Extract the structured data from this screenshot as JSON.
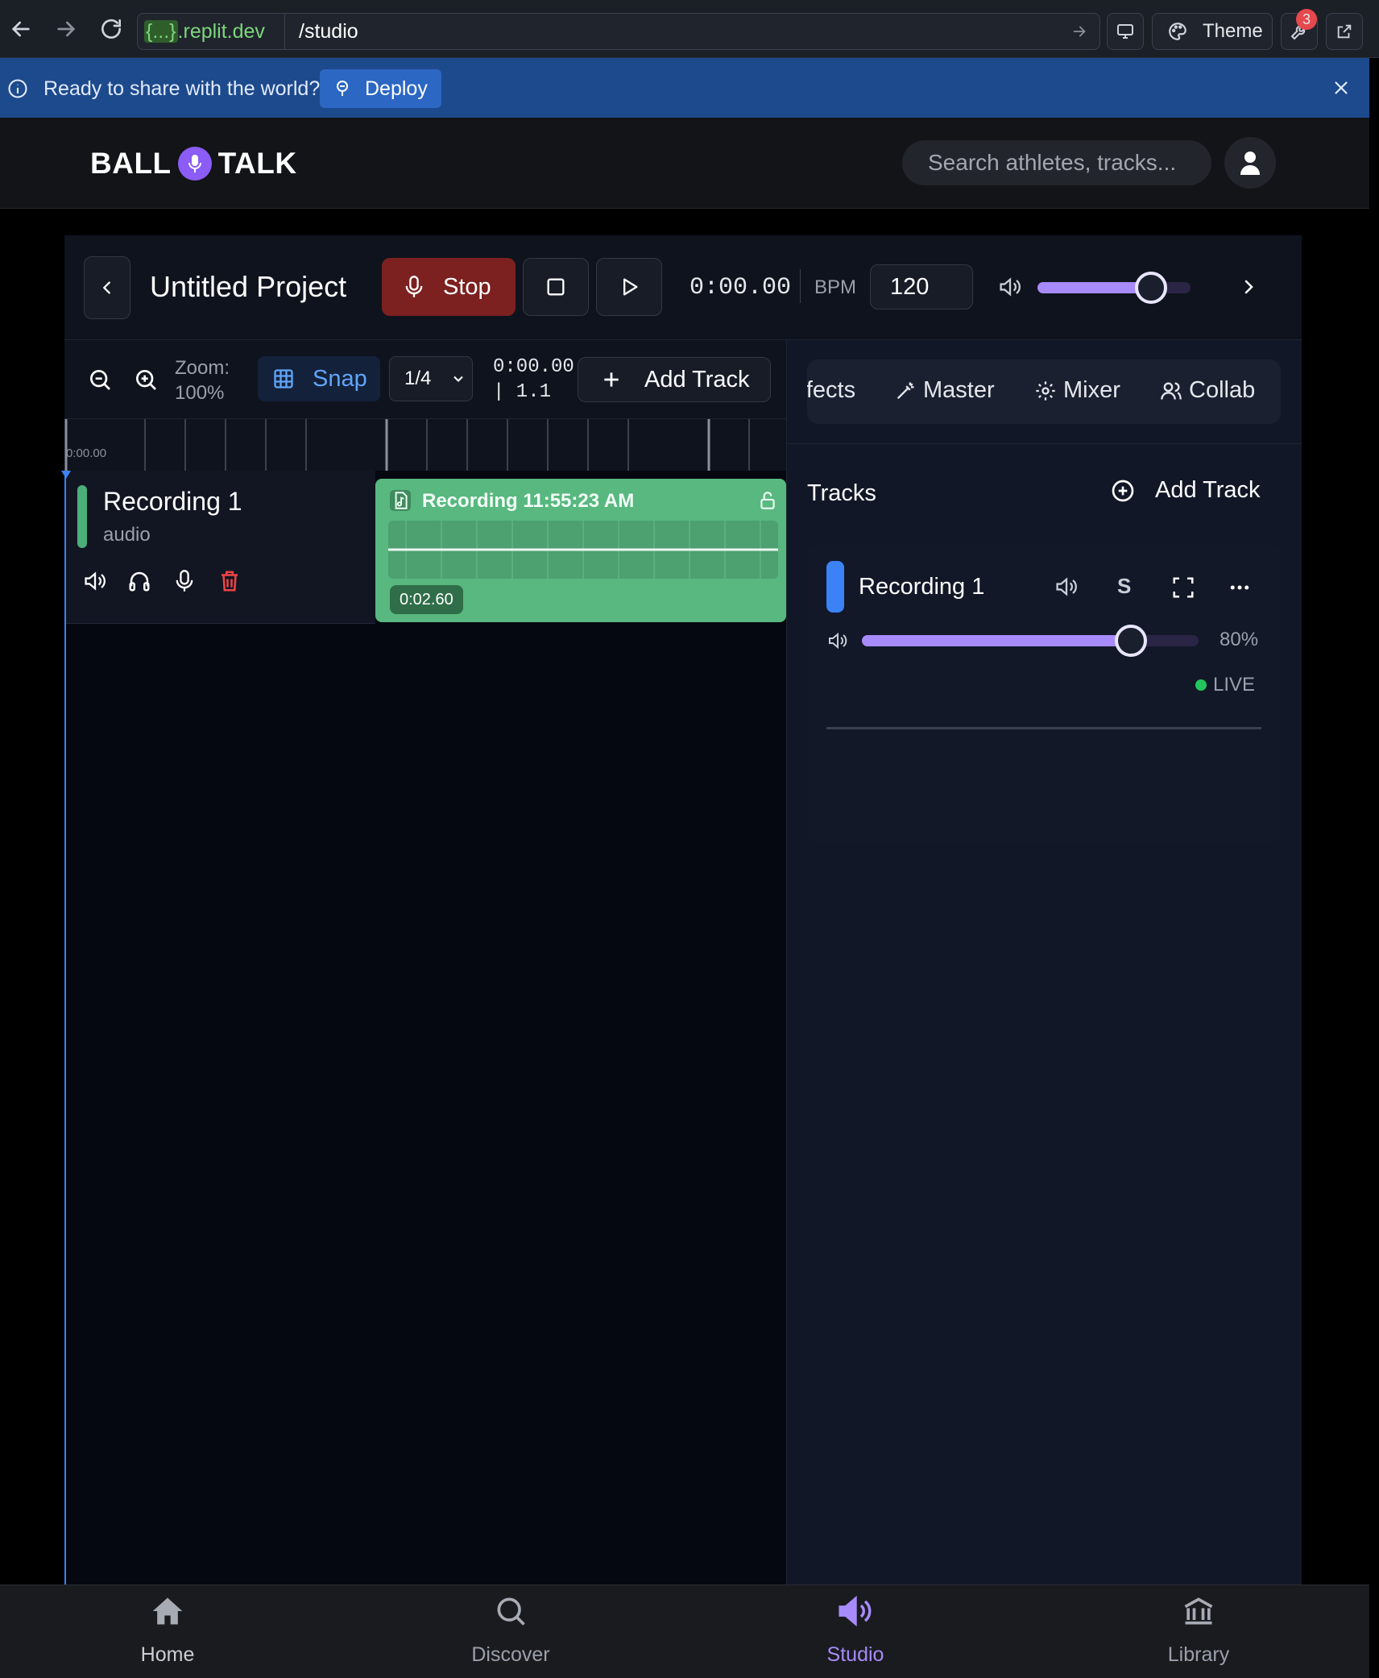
{
  "browser": {
    "url_host": "{...}.replit.dev",
    "url_host_brace": "{...}",
    "url_host_rest": ".replit.dev",
    "url_path": "/studio",
    "theme_label": "Theme",
    "notification_count": "3"
  },
  "banner": {
    "message": "Ready to share with the world?",
    "deploy_label": "Deploy"
  },
  "header": {
    "logo_left": "BALL",
    "logo_right": "TALK",
    "search_placeholder": "Search athletes, tracks..."
  },
  "transport": {
    "project_title": "Untitled Project",
    "stop_label": "Stop",
    "time": "0:00.00",
    "bpm_label": "BPM",
    "bpm_value": "120",
    "master_volume": 0.74
  },
  "toolbar": {
    "zoom_label": "Zoom:",
    "zoom_value": "100%",
    "snap_label": "Snap",
    "grid_value": "1/4",
    "position_time": "0:00.00",
    "position_bar": "| 1.1",
    "add_track_label": "Add Track"
  },
  "ruler": {
    "start_label": "0:00.00"
  },
  "tracks": [
    {
      "name": "Recording 1",
      "type": "audio",
      "color": "#4caf7a",
      "clip": {
        "title": "Recording 11:55:23 AM",
        "duration": "0:02.60",
        "color": "#58b87f"
      }
    }
  ],
  "panel": {
    "tabs": [
      "Effects",
      "Master",
      "Mixer",
      "Collab"
    ],
    "tracks_heading": "Tracks",
    "add_track_label": "Add Track",
    "mixer_track": {
      "name": "Recording 1",
      "solo_label": "S",
      "volume_percent": "80%",
      "volume": 0.8,
      "status": "LIVE",
      "color": "#3b82f6"
    }
  },
  "bottom_nav": [
    {
      "label": "Home",
      "icon": "home-icon"
    },
    {
      "label": "Discover",
      "icon": "search-icon"
    },
    {
      "label": "Studio",
      "icon": "speaker-icon",
      "active": true
    },
    {
      "label": "Library",
      "icon": "library-icon"
    }
  ],
  "colors": {
    "accent": "#a78bfa",
    "stop": "#7c2020",
    "banner": "#1d4a8c",
    "live": "#22c55e"
  }
}
